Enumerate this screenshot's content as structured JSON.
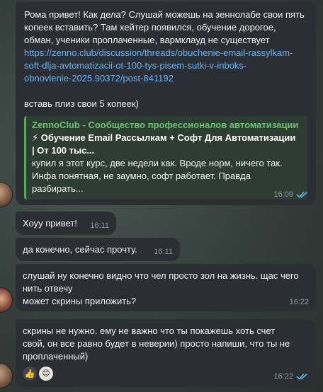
{
  "messages": [
    {
      "id": "m1",
      "text_line1": "Рома привет! Как дела? Слушай можешь на зеннолабе свои пять",
      "text_line2": "копеек вставить? Там хейтер появился, обучение дорогое,",
      "text_line3": "обман, ученики проплаченные, вармклауд не существует",
      "link_line1": "https://zenno.club/discussion/threads/obuchenie-email-rassylkam-",
      "link_line2": "soft-dlja-avtomatizacii-ot-100-tys-pisem-sutki-v-inboks-",
      "link_line3": "obnovlenie-2025.90372/post-841192",
      "text_after": "вставь плиз свои 5 копеек)",
      "preview": {
        "site": "ZennoClub - Сообщество профессионалов автоматизации",
        "title_line1": "⚡ Обучение Email Рассылкам + Софт Для Автоматизации",
        "title_line2": "| От 100 тыс...",
        "desc_line1": "купил я этот курс, две недели как. Вроде норм, ничего так.",
        "desc_line2": "Инфа понятная, не заумно, софт работает. Правда разбирать..."
      },
      "time": "16:09"
    },
    {
      "id": "m2",
      "text": "Хоуу привет!",
      "time": "16:11"
    },
    {
      "id": "m3",
      "text": "да конечно, сейчас прочту.",
      "time": "16:11"
    },
    {
      "id": "m4",
      "text_line1": "слушай ну конечно видно что чел просто зол на жизнь. щас чего",
      "text_line2": "нить отвечу",
      "text_line3": "может скрины приложить?",
      "time": "16:22"
    },
    {
      "id": "m5",
      "text_line1": "скрины не нужно.  ему не важно что ты покажешь хоть счет",
      "text_line2": "свой, он все равно будет в неверии) просто напиши, что ты не",
      "text_line3": "проплаченный)",
      "reactions": [
        "👍",
        "😊"
      ],
      "time": "16:22"
    }
  ],
  "colors": {
    "link": "#6ab3f3",
    "check": "#5fb8e6",
    "preview_accent": "#4fae4e"
  },
  "icons": [
    "double-check-icon",
    "avatar",
    "thumbs-up-reaction",
    "face-reaction"
  ]
}
